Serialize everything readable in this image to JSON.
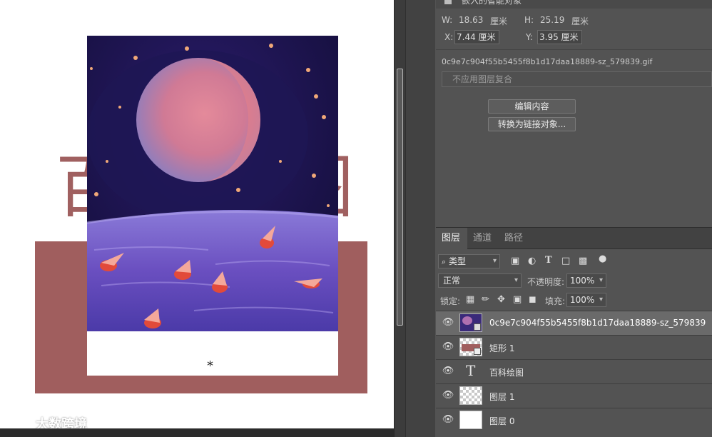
{
  "colors": {
    "canvas_bg": "#ffffff",
    "rect_fill": "#a05e5e",
    "big_text": "#a06060",
    "panel_bg": "#535353",
    "selected_row": "#6a6a6a"
  },
  "canvas": {
    "big_text_left": "百",
    "big_text_right": "图",
    "star": "*"
  },
  "watermark": {
    "text": "大数跨境"
  },
  "properties": {
    "header_text": "嵌入的智能对象",
    "w_label": "W:",
    "w_value": "18.63",
    "w_unit": "厘米",
    "h_label": "H:",
    "h_value": "25.19",
    "h_unit": "厘米",
    "x_label": "X:",
    "x_value": "7.44 厘米",
    "y_label": "Y:",
    "y_value": "3.95 厘米",
    "filename": "0c9e7c904f55b5455f8b1d17daa18889-sz_579839.gif",
    "layer_comp_placeholder": "不应用图层复合",
    "edit_contents_button": "编辑内容",
    "convert_to_linked_button": "转换为链接对象..."
  },
  "layers_panel": {
    "tabs": [
      {
        "label": "图层",
        "active": true
      },
      {
        "label": "通道",
        "active": false
      },
      {
        "label": "路径",
        "active": false
      }
    ],
    "filter_kind": "类型",
    "blend_mode": "正常",
    "opacity_label": "不透明度:",
    "opacity_value": "100%",
    "lock_label": "锁定:",
    "fill_label": "填充:",
    "fill_value": "100%",
    "layers": [
      {
        "name": "0c9e7c904f55b5455f8b1d17daa18889-sz_579839",
        "type": "smart-object",
        "selected": true,
        "visible": true
      },
      {
        "name": "矩形 1",
        "type": "shape",
        "selected": false,
        "visible": true
      },
      {
        "name": "百科绘图",
        "type": "text",
        "selected": false,
        "visible": true
      },
      {
        "name": "图层 1",
        "type": "pixel-transparent",
        "selected": false,
        "visible": true
      },
      {
        "name": "图层 0",
        "type": "pixel-white",
        "selected": false,
        "visible": true
      }
    ]
  }
}
